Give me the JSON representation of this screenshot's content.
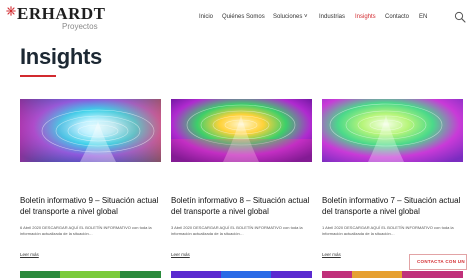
{
  "brand": {
    "name": "ERHARDT",
    "subtitle": "Proyectos",
    "accent": "#d22a2f"
  },
  "nav": {
    "items": [
      {
        "label": "Inicio"
      },
      {
        "label": "Quiénes Somos"
      },
      {
        "label": "Soluciones ˅"
      },
      {
        "label": "Industrias"
      },
      {
        "label": "Insights"
      },
      {
        "label": "Contacto"
      },
      {
        "label": "EN"
      }
    ],
    "active": "Insights",
    "search_icon": "search-icon"
  },
  "page": {
    "title": "Insights"
  },
  "cards": [
    {
      "title": "Boletín informativo 9 – Situación actual del transporte a nivel global",
      "excerpt": "6 Abril 2020 DESCARGAR AQUÍ EL BOLETÍN INFORMATIVO con toda la información actualizada de la situación…",
      "more": "Leer más"
    },
    {
      "title": "Boletín informativo 8 – Situación actual del transporte a nivel global",
      "excerpt": "3 Abril 2020 DESCARGAR AQUÍ EL BOLETÍN INFORMATIVO con toda la información actualizada de la situación…",
      "more": "Leer más"
    },
    {
      "title": "Boletín informativo 7 – Situación actual del transporte a nivel global",
      "excerpt": "1 Abril 2020 DESCARGAR AQUÍ EL BOLETÍN INFORMATIVO con toda la información actualizada de la situación…",
      "more": "Leer más"
    }
  ],
  "contact_button": {
    "label": "CONTACTA CON UN EXPERTO"
  }
}
